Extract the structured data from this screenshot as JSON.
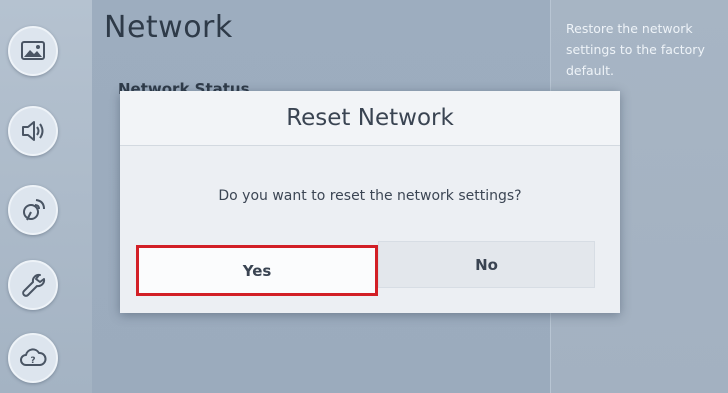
{
  "screen": {
    "title": "Network",
    "section_label": "Network Status",
    "help_text": "Restore the network settings to the factory default."
  },
  "side_menu": {
    "items": [
      {
        "icon": "picture-icon"
      },
      {
        "icon": "sound-icon"
      },
      {
        "icon": "broadcast-icon"
      },
      {
        "icon": "wrench-icon"
      },
      {
        "icon": "support-cloud-icon"
      }
    ]
  },
  "dialog": {
    "title": "Reset Network",
    "message": "Do you want to reset the network settings?",
    "yes_label": "Yes",
    "no_label": "No",
    "focused": "Yes"
  },
  "colors": {
    "focus_outline": "#d21f26",
    "background": "#a9b7c6",
    "dialog_bg": "#eceff3"
  }
}
